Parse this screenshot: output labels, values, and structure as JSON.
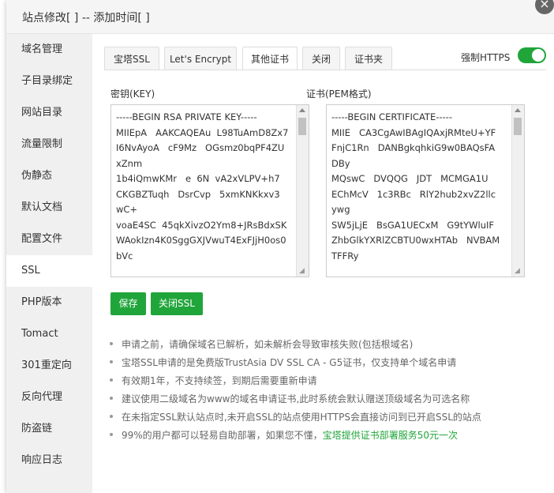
{
  "dialog": {
    "title": "站点修改[              ] -- 添加时间[                        ]",
    "close_icon": "close-icon"
  },
  "sidebar": {
    "items": [
      {
        "label": "域名管理"
      },
      {
        "label": "子目录绑定"
      },
      {
        "label": "网站目录"
      },
      {
        "label": "流量限制"
      },
      {
        "label": "伪静态"
      },
      {
        "label": "默认文档"
      },
      {
        "label": "配置文件"
      },
      {
        "label": "SSL",
        "active": true
      },
      {
        "label": "PHP版本"
      },
      {
        "label": "Tomact"
      },
      {
        "label": "301重定向"
      },
      {
        "label": "反向代理"
      },
      {
        "label": "防盗链"
      },
      {
        "label": "响应日志"
      }
    ]
  },
  "tabs": [
    {
      "label": "宝塔SSL"
    },
    {
      "label": "Let's Encrypt"
    },
    {
      "label": "其他证书",
      "active": true
    },
    {
      "label": "关闭"
    },
    {
      "label": "证书夹"
    }
  ],
  "force_https": {
    "label": "强制HTTPS",
    "on": true,
    "color": "#20a53a"
  },
  "key_field": {
    "label": "密钥(KEY)",
    "value": "-----BEGIN RSA PRIVATE KEY-----\nMIIEpA   AAKCAQEAu  L98TuAmD8Zx7\nI6NvAyoA   cF9Mz   OGsmz0bqPF4ZU\nxZnm\n1b4iQmwKMr   e  6N  vA2xVLPV+h7\nCKGBZTuqh   DsrCvp   5xmKNKkxv3\nwC+\nvoaE4SC  45qkXivzO2Ym8+JRsBdxSK\nWAokIzn4K0SggGXJVwuT4ExFJjH0os0\nbVc"
  },
  "cert_field": {
    "label": "证书(PEM格式)",
    "value": "-----BEGIN CERTIFICATE-----\nMIIE   CA3CgAwIBAgIQAxjRMteU+YF\nFnjC1Rn   DANBgkqhkiG9w0BAQsFA\nDBy\nMQswC   DVQQG   JDT   MCMGA1U\nEChMcV   1c3RBc   RlY2hub2xvZ2llc\nywg\nSW5jLjE   BsGA1UECxM   G9tYWluIF\nZhbGlkYXRlZCBTU0wxHTAb   NVBAM\nTFFRy"
  },
  "buttons": {
    "save": "保存",
    "close_ssl": "关闭SSL"
  },
  "notes": [
    {
      "text": "申请之前，请确保域名已解析，如未解析会导致审核失败(包括根域名)"
    },
    {
      "text": "宝塔SSL申请的是免费版TrustAsia DV SSL CA - G5证书，仅支持单个域名申请"
    },
    {
      "text": "有效期1年，不支持续签，到期后需要重新申请"
    },
    {
      "text": "建议使用二级域名为www的域名申请证书,此时系统会默认赠送顶级域名为可选名称"
    },
    {
      "text": "在未指定SSL默认站点时,未开启SSL的站点使用HTTPS会直接访问到已开启SSL的站点"
    },
    {
      "text": "99%的用户都可以轻易自助部署，如果您不懂，",
      "link": "宝塔提供证书部署服务50元一次"
    }
  ]
}
